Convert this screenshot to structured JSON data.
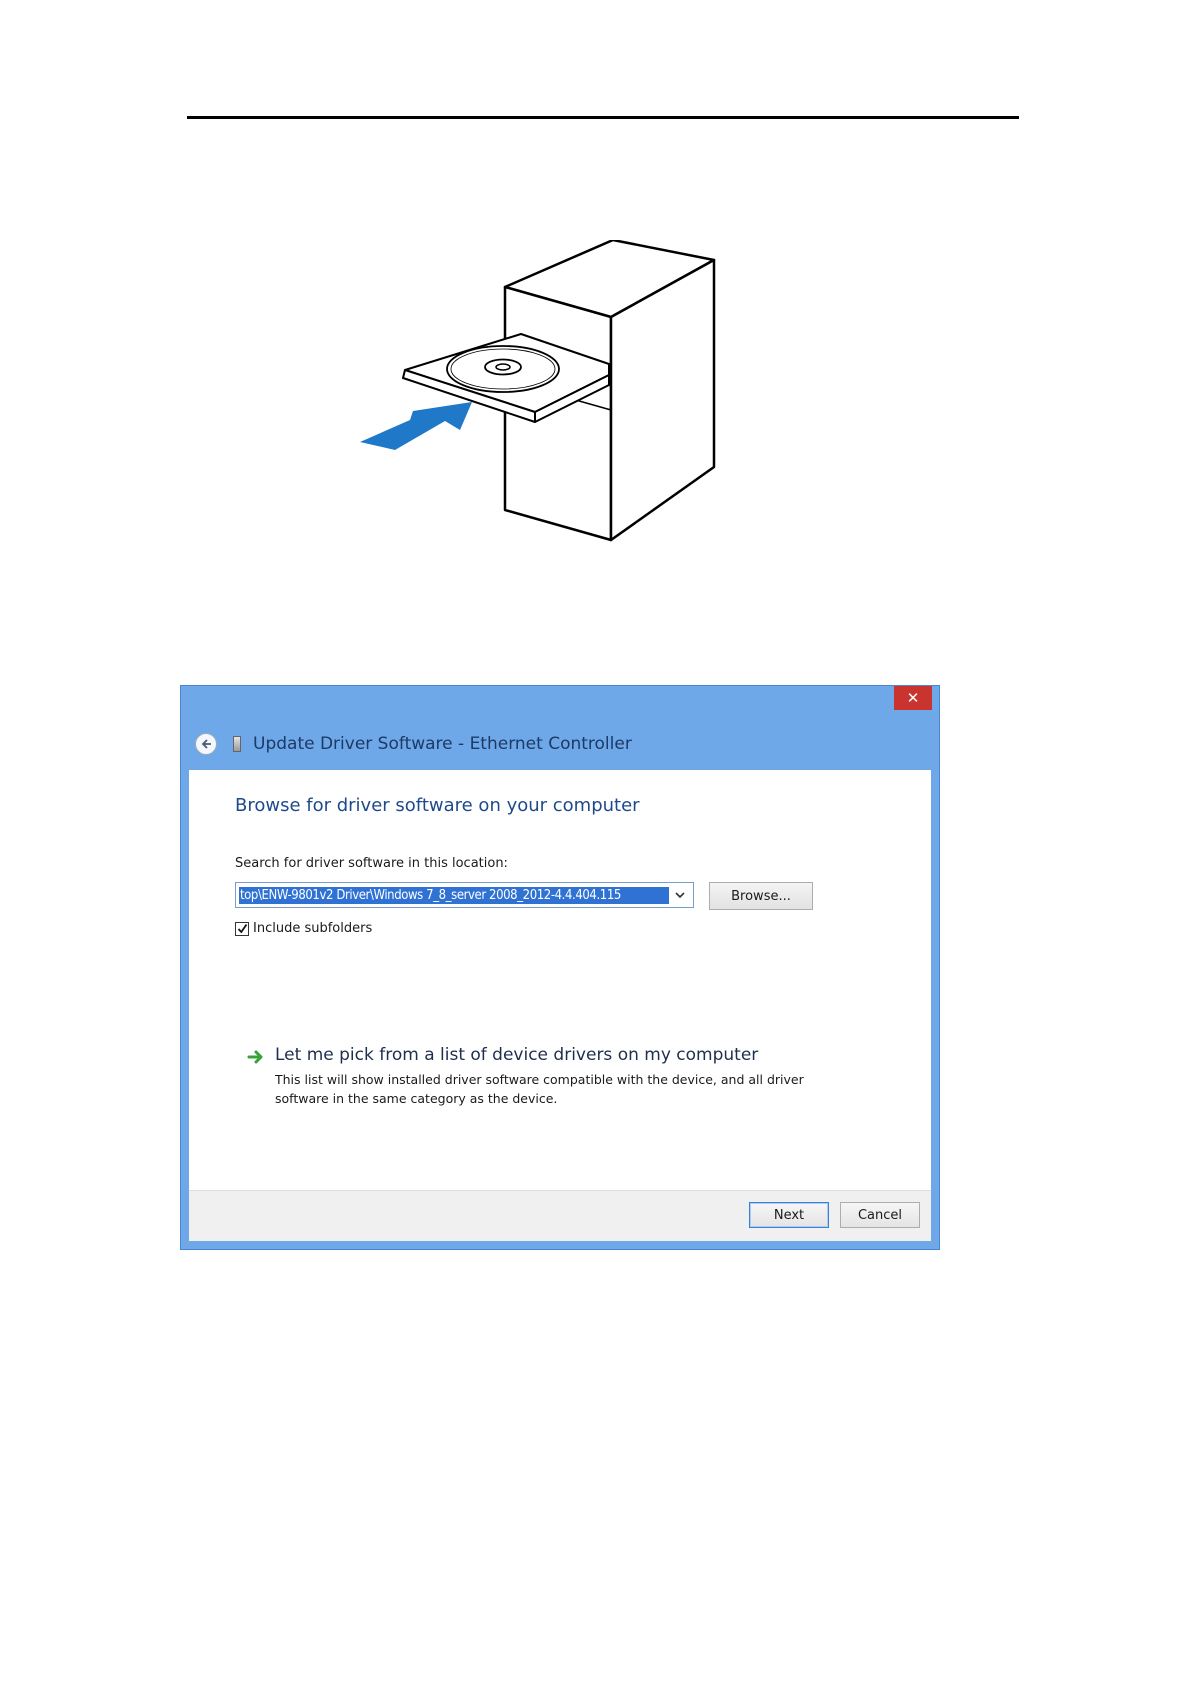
{
  "dialog": {
    "title": "Update Driver Software - Ethernet Controller",
    "close_glyph": "✕",
    "heading": "Browse for driver software on your computer",
    "search_label": "Search for driver software in this location:",
    "path_value": "top\\ENW-9801v2 Driver\\Windows 7_8_server 2008_2012-4.4.404.115",
    "browse_label": "Browse...",
    "include_subfolders_label": "Include subfolders",
    "include_subfolders_checked": true,
    "pick_title": "Let me pick from a list of device drivers on my computer",
    "pick_description": "This list will show installed driver software compatible with the device, and all driver software in the same category as the device.",
    "next_label": "Next",
    "cancel_label": "Cancel"
  },
  "icons": {
    "back": "back-arrow-icon",
    "device": "device-icon",
    "combo": "chevron-down-icon",
    "check": "checkmark-icon",
    "pick": "green-arrow-icon",
    "illustration_arrow": "insert-arrow-icon"
  },
  "colors": {
    "window_frame": "#6ea8e8",
    "close_button": "#c9342e",
    "heading_text": "#1e4a8c",
    "selection": "#2f72d4",
    "insert_arrow": "#1f78c8",
    "pick_arrow": "#3aa03a"
  }
}
